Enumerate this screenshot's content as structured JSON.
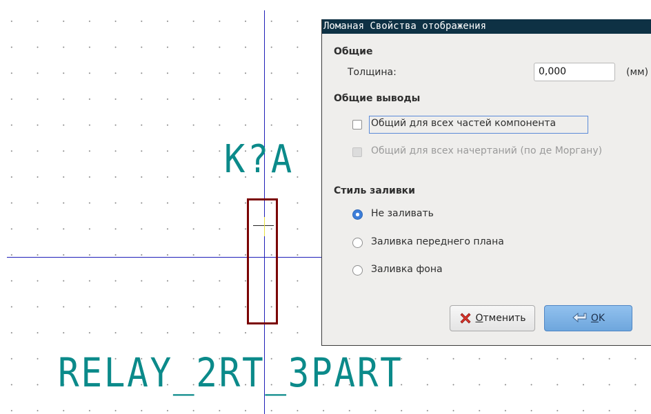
{
  "schematic": {
    "reference": "K?A",
    "value": "RELAY_2RT_3PART",
    "colors": {
      "text": "#0b8a8a",
      "body": "#7a0000",
      "axis": "#1d1db8"
    }
  },
  "dialog": {
    "title": "Ломаная Свойства отображения",
    "general_section": "Общие",
    "thickness_label": "Толщина:",
    "thickness_value": "0,000",
    "thickness_unit": "(мм)",
    "shared_section": "Общие выводы",
    "shared_all_units": {
      "label": "Общий для всех частей компонента",
      "checked": false
    },
    "shared_all_convert": {
      "label": "Общий для всех начертаний (по де Моргану)",
      "checked": false,
      "enabled": false
    },
    "fill_section": "Стиль заливки",
    "fill_options": [
      {
        "label": "Не заливать",
        "selected": true
      },
      {
        "label": "Заливка переднего плана",
        "selected": false
      },
      {
        "label": "Заливка фона",
        "selected": false
      }
    ],
    "cancel_label_first": "О",
    "cancel_label_rest": "тменить",
    "ok_label_first": "O",
    "ok_label_rest": "K"
  }
}
